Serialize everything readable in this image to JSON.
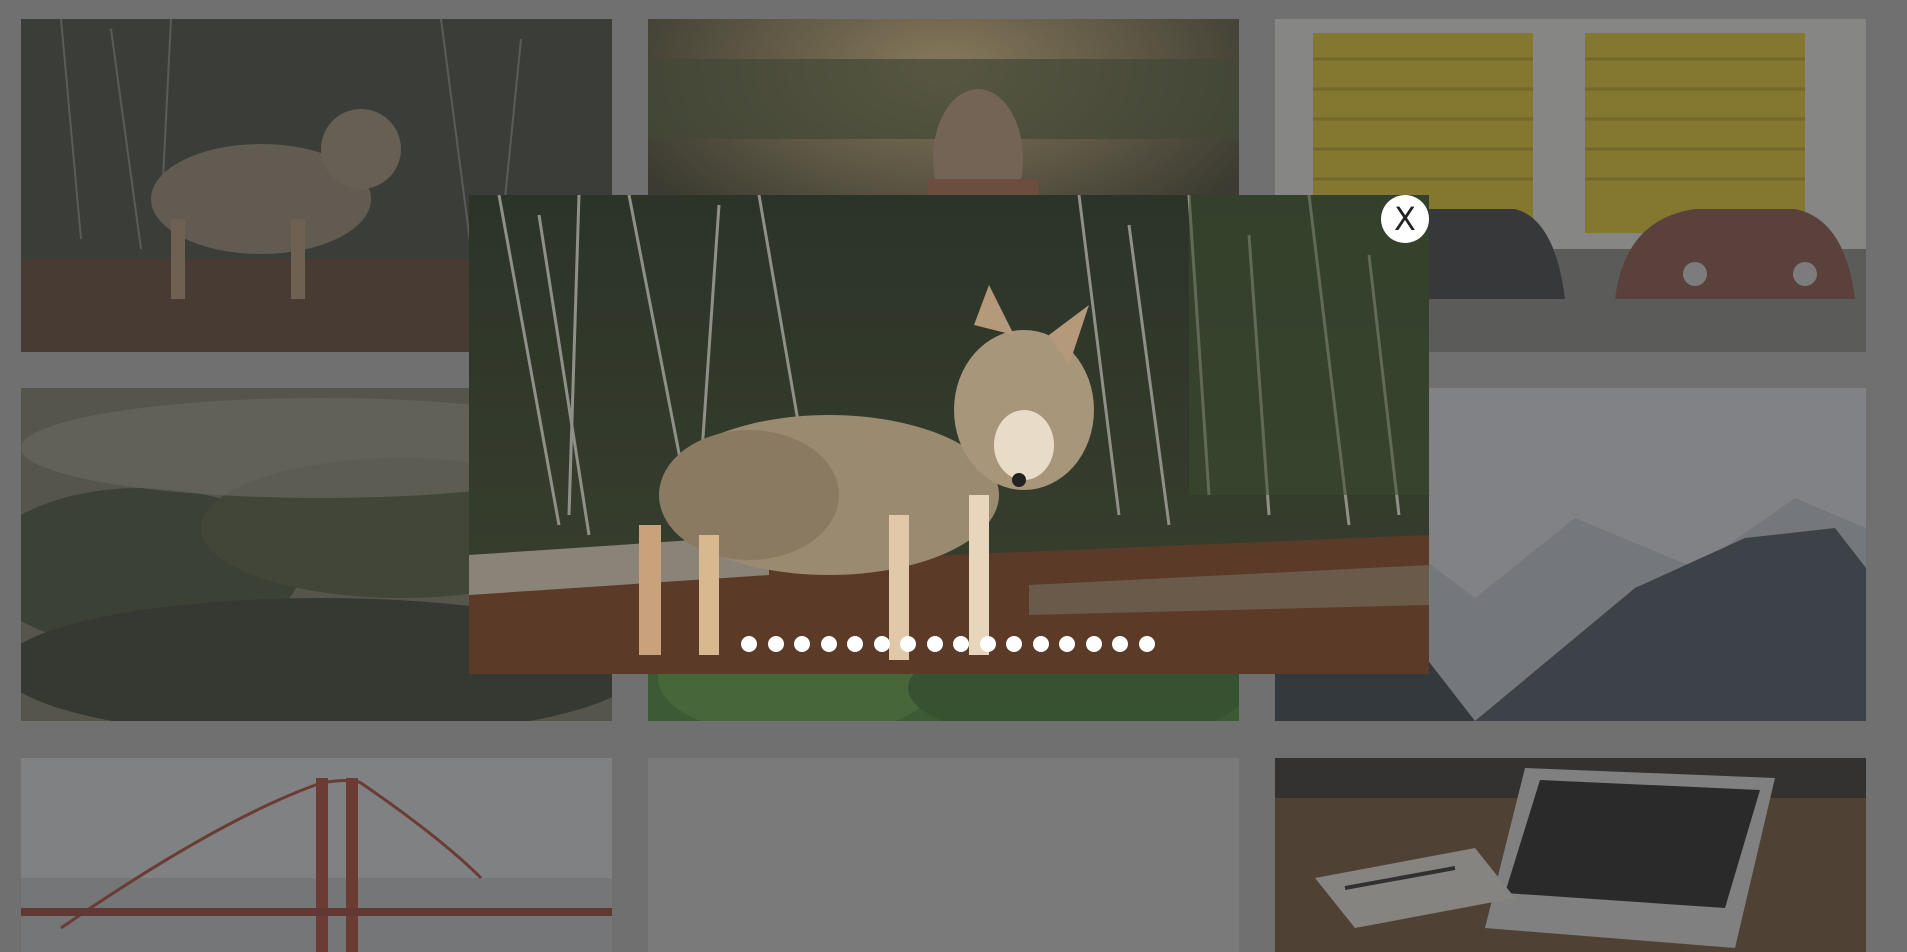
{
  "gallery": {
    "tiles": [
      {
        "subject": "coyote"
      },
      {
        "subject": "woman-sunset"
      },
      {
        "subject": "vintage-cars-garage"
      },
      {
        "subject": "foggy-forest"
      },
      {
        "subject": "green-leaves"
      },
      {
        "subject": "mountains"
      },
      {
        "subject": "golden-gate-bridge"
      },
      {
        "subject": "blank"
      },
      {
        "subject": "laptop-desk"
      }
    ]
  },
  "lightbox": {
    "image_subject": "coyote",
    "close_label": "X",
    "slide_count": 16,
    "active_slide": 1
  },
  "colors": {
    "overlay": "#3c3c3c",
    "dot": "#ffffff",
    "close_bg": "#ffffff"
  }
}
